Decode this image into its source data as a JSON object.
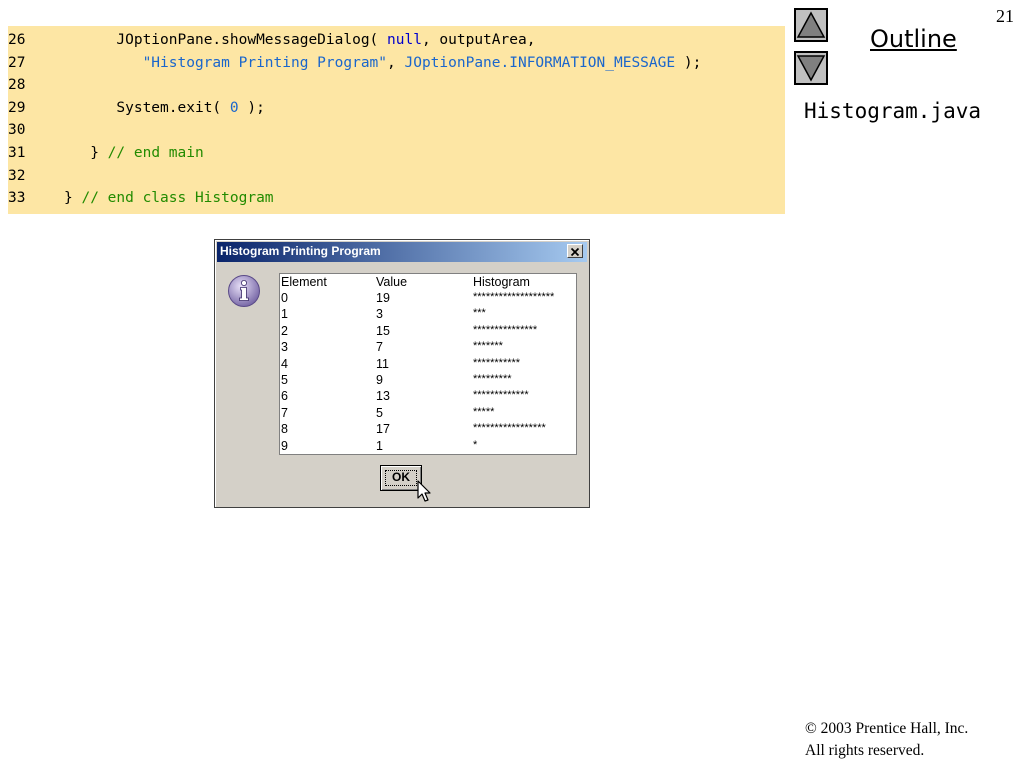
{
  "slide": {
    "page_number": "21",
    "outline_label": "Outline",
    "file_name": "Histogram.java",
    "copyright": [
      "© 2003 Prentice Hall, Inc.",
      "All rights reserved."
    ]
  },
  "code_lines": [
    {
      "num": "26",
      "indent": 12,
      "parts": [
        {
          "t": "JOptionPane.showMessageDialog( ",
          "c": "plain"
        },
        {
          "t": "null",
          "c": "kw"
        },
        {
          "t": ", outputArea,",
          "c": "plain"
        }
      ]
    },
    {
      "num": "27",
      "indent": 15,
      "parts": [
        {
          "t": "\"Histogram Printing Program\"",
          "c": "str"
        },
        {
          "t": ", ",
          "c": "plain"
        },
        {
          "t": "JOptionPane.INFORMATION_MESSAGE",
          "c": "str"
        },
        {
          "t": " );",
          "c": "plain"
        }
      ]
    },
    {
      "num": "28",
      "indent": 0,
      "parts": []
    },
    {
      "num": "29",
      "indent": 12,
      "parts": [
        {
          "t": "System.exit( ",
          "c": "plain"
        },
        {
          "t": "0",
          "c": "num"
        },
        {
          "t": " );",
          "c": "plain"
        }
      ]
    },
    {
      "num": "30",
      "indent": 0,
      "parts": []
    },
    {
      "num": "31",
      "indent": 9,
      "parts": [
        {
          "t": "} ",
          "c": "plain"
        },
        {
          "t": "// end main",
          "c": "cm"
        }
      ]
    },
    {
      "num": "32",
      "indent": 0,
      "parts": []
    },
    {
      "num": "33",
      "indent": 6,
      "parts": [
        {
          "t": "} ",
          "c": "plain"
        },
        {
          "t": "// end class Histogram",
          "c": "cm"
        }
      ]
    }
  ],
  "dialog": {
    "title": "Histogram Printing Program",
    "close_glyph": "✕",
    "ok_label": "OK",
    "headers": {
      "element": "Element",
      "value": "Value",
      "histogram": "Histogram"
    },
    "rows": [
      {
        "element": "0",
        "value": 19
      },
      {
        "element": "1",
        "value": 3
      },
      {
        "element": "2",
        "value": 15
      },
      {
        "element": "3",
        "value": 7
      },
      {
        "element": "4",
        "value": 11
      },
      {
        "element": "5",
        "value": 9
      },
      {
        "element": "6",
        "value": 13
      },
      {
        "element": "7",
        "value": 5
      },
      {
        "element": "8",
        "value": 17
      },
      {
        "element": "9",
        "value": 1
      }
    ]
  },
  "colors": {
    "code_background": "#fde6a4",
    "keyword": "#0000cc",
    "string": "#1a66cc",
    "comment": "#228b00",
    "titlebar_start": "#0a246a"
  }
}
